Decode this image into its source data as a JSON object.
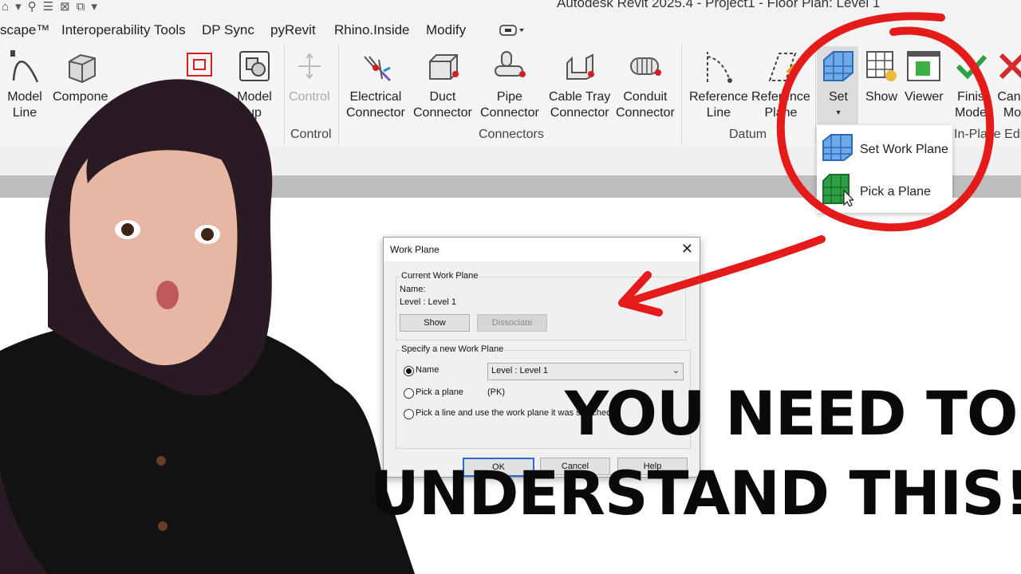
{
  "window": {
    "title": "Autodesk Revit 2025.4 - Project1 - Floor Plan: Level 1"
  },
  "tabs": [
    "scape™",
    "Interoperability Tools",
    "DP Sync",
    "pyRevit",
    "Rhino.Inside",
    "Modify"
  ],
  "ribbon": {
    "model": {
      "model_line": [
        "Model",
        "Line"
      ],
      "component": [
        "Compone"
      ],
      "model_group": [
        "Model",
        "up"
      ]
    },
    "control": {
      "button": "Control",
      "panel": "Control"
    },
    "connectors": {
      "electrical": [
        "Electrical",
        "Connector"
      ],
      "duct": [
        "Duct",
        "Connector"
      ],
      "pipe": [
        "Pipe",
        "Connector"
      ],
      "cable_tray": [
        "Cable Tray",
        "Connector"
      ],
      "conduit": [
        "Conduit",
        "Connector"
      ],
      "panel": "Connectors"
    },
    "datum": {
      "reference_line": [
        "Reference",
        "Line"
      ],
      "reference_plane": [
        "Reference",
        "Plane"
      ],
      "panel": "Datum"
    },
    "work_plane": {
      "set": "Set",
      "show": "Show",
      "viewer": "Viewer"
    },
    "in_place": {
      "finish": [
        "Finis",
        "Mode"
      ],
      "cancel": [
        "Canc",
        "Mo"
      ],
      "panel": "In-Place Edi"
    }
  },
  "set_dropdown": {
    "items": [
      "Set Work Plane",
      "Pick a Plane"
    ]
  },
  "dialog": {
    "title": "Work Plane",
    "current_group": "Current Work Plane",
    "name_label": "Name:",
    "name_value": "Level : Level 1",
    "show_btn": "Show",
    "dissociate_btn": "Dissociate",
    "specify_group": "Specify a new Work Plane",
    "opt_name": "Name",
    "select_value": "Level : Level 1",
    "opt_pick": "Pick a plane",
    "pick_shortcut": "(PK)",
    "opt_line": "Pick a line and use the work plane it was sketched",
    "ok": "OK",
    "cancel": "Cancel",
    "help": "Help"
  },
  "headline": {
    "line1": "YOU NEED TO",
    "line2": "UNDERSTAND THIS!"
  },
  "colors": {
    "annotation_red": "#e51b1b",
    "ribbon_bg": "#f5f5f5",
    "dialog_bg": "#f0f0f0"
  }
}
